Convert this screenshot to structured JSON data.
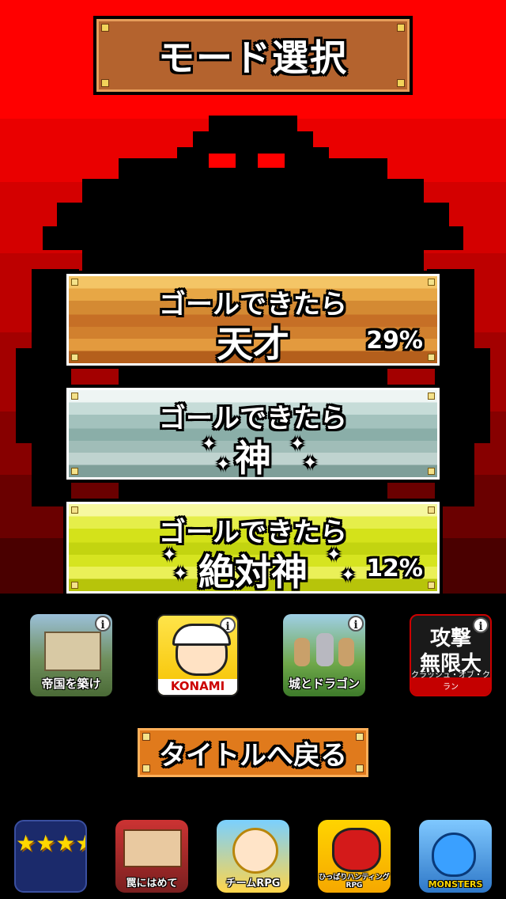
{
  "title": "モード選択",
  "modes": [
    {
      "line1": "ゴールできたら",
      "line2": "天才",
      "percent": "29%"
    },
    {
      "line1": "ゴールできたら",
      "line2": "神",
      "percent": ""
    },
    {
      "line1": "ゴールできたら",
      "line2": "絶対神",
      "percent": "12%"
    }
  ],
  "ads": [
    {
      "caption": "帝国を築け",
      "info": "i"
    },
    {
      "caption": "KONAMI",
      "info": "i"
    },
    {
      "caption": "城とドラゴン",
      "info": "i"
    },
    {
      "caption_top": "攻撃",
      "caption_bottom": "無限大",
      "caption_small": "クラッシュ・オブ・クラン",
      "info": "i"
    }
  ],
  "back_button": "タイトルへ戻る",
  "bottom_icons": [
    {
      "caption": "★★★★★★"
    },
    {
      "caption": "罠にはめて"
    },
    {
      "caption": "チームRPG"
    },
    {
      "caption": "ひっぱりハンティングRPG"
    },
    {
      "caption": "MONSTERS"
    }
  ],
  "colors": {
    "title_bg": "#b4632e",
    "back_bg": "#e07a1c",
    "monster": "#000000",
    "monster_eyes": "#ff0000"
  }
}
